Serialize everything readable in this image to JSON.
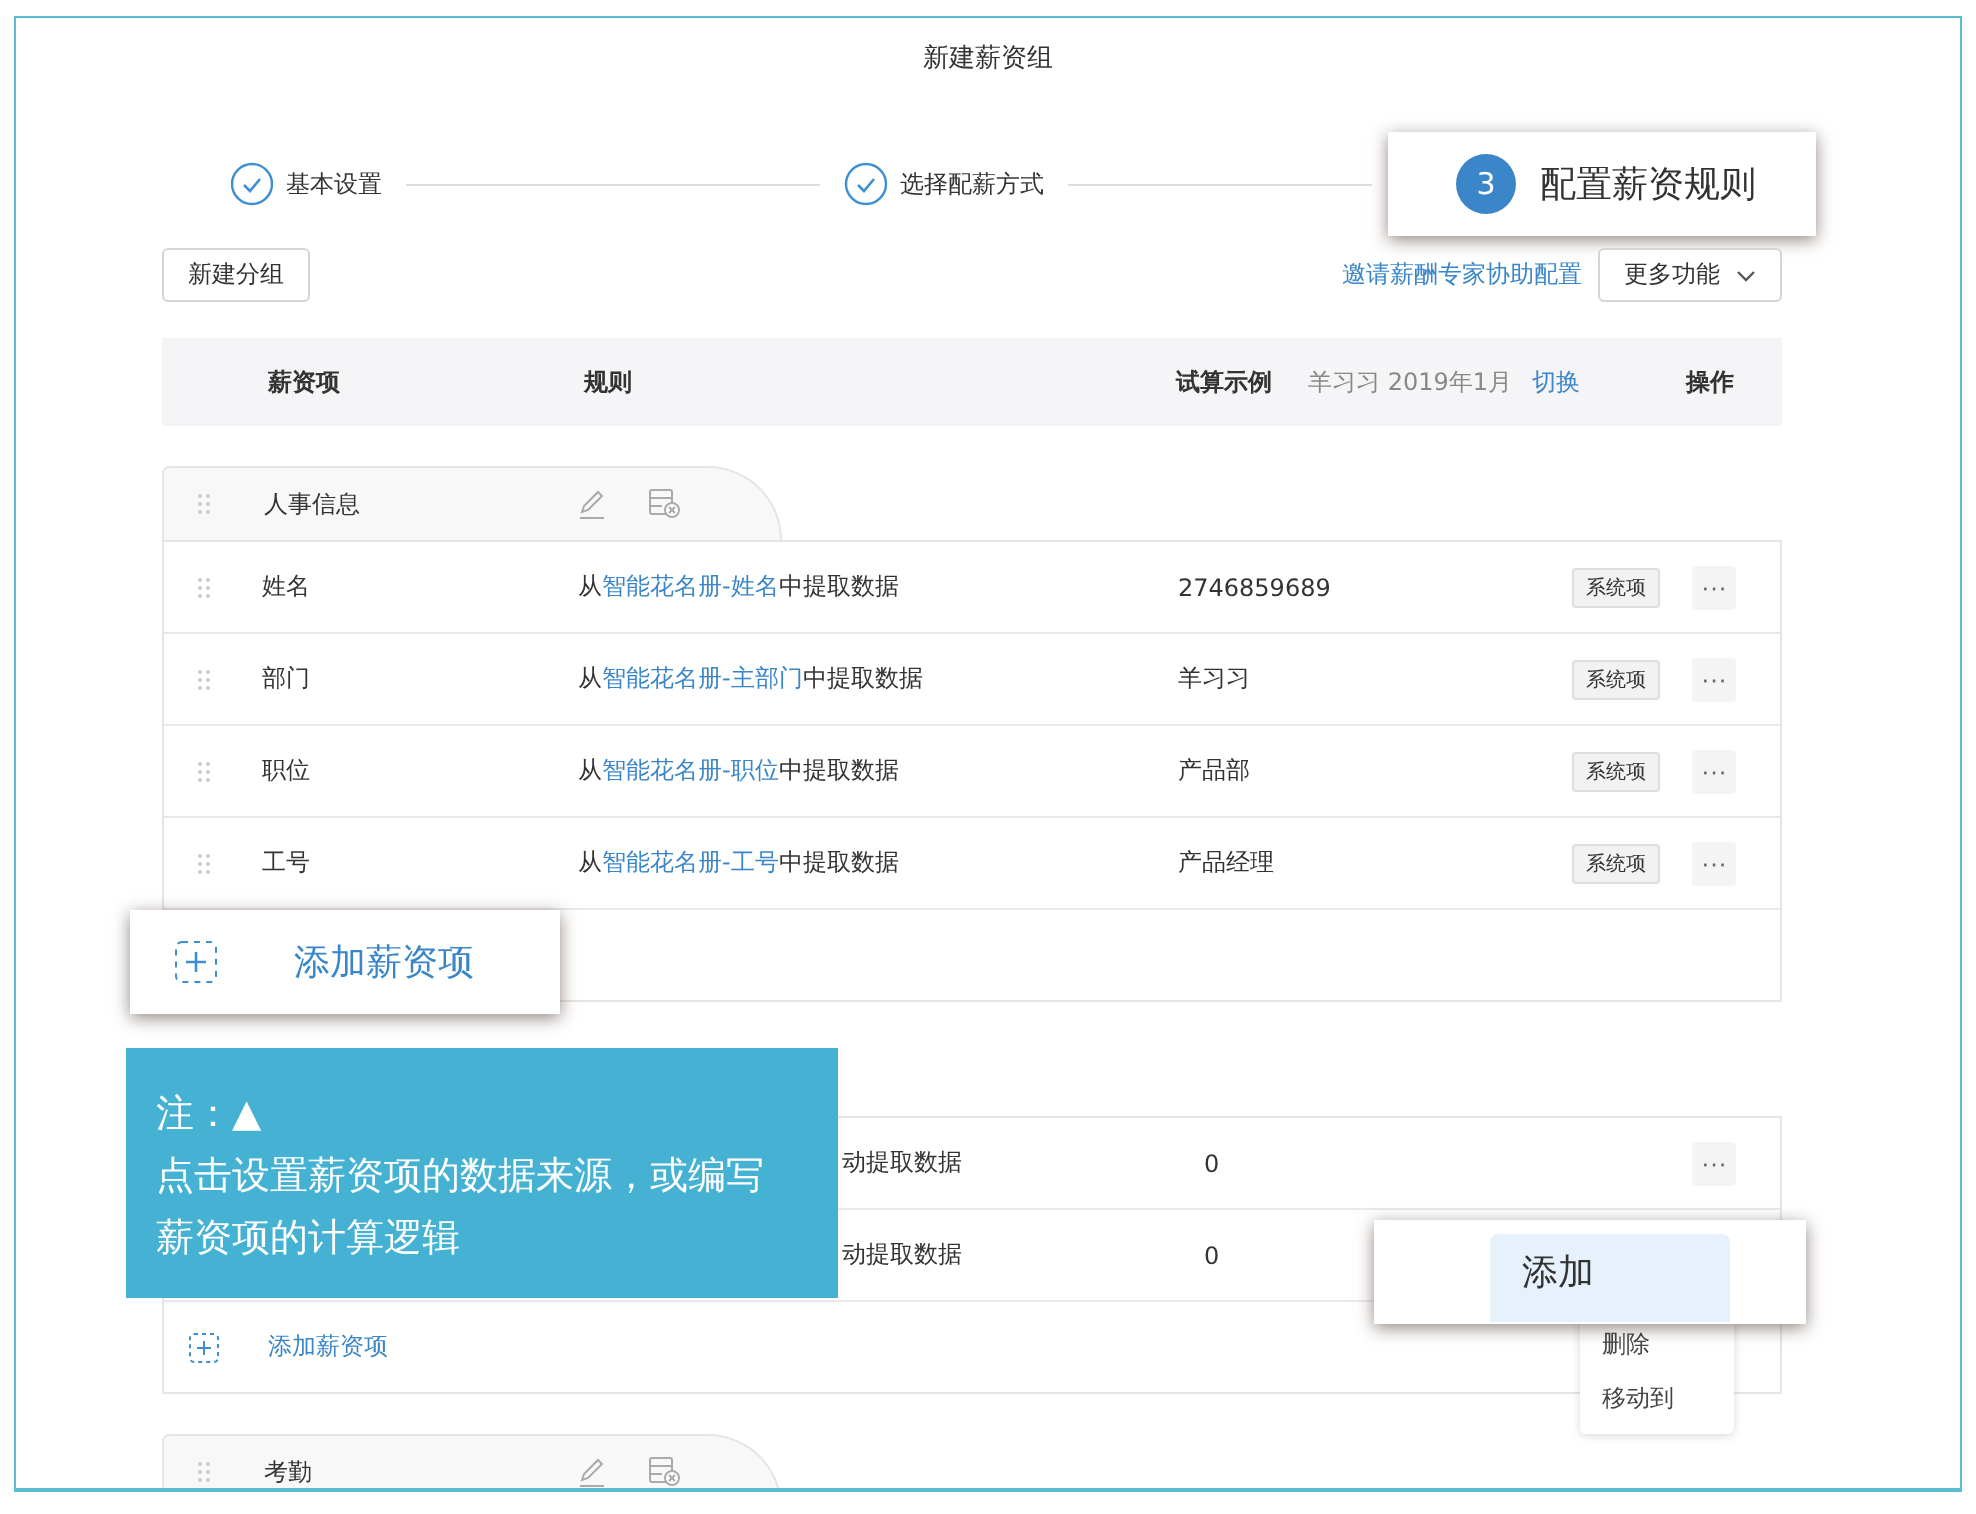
{
  "title": "新建薪资组",
  "steps": [
    {
      "label": "基本设置",
      "done": true
    },
    {
      "label": "选择配薪方式",
      "done": true
    },
    {
      "label": "配置薪资规则",
      "done": false,
      "number": "3"
    }
  ],
  "toolbar": {
    "new_group": "新建分组",
    "invite_link": "邀请薪酬专家协助配置",
    "more": "更多功能"
  },
  "header": {
    "item": "薪资项",
    "rule": "规则",
    "sample": "试算示例",
    "sample_person": "羊习习 2019年1月",
    "switch": "切换",
    "actions": "操作"
  },
  "groups": [
    {
      "name": "人事信息",
      "rows": [
        {
          "name": "姓名",
          "rule_before": "从",
          "rule_link": "智能花名册-姓名",
          "rule_after": "中提取数据",
          "sample": "2746859689",
          "tag": "系统项",
          "more": "···"
        },
        {
          "name": "部门",
          "rule_before": "从",
          "rule_link": "智能花名册-主部门",
          "rule_after": "中提取数据",
          "sample": "羊习习",
          "tag": "系统项",
          "more": "···"
        },
        {
          "name": "职位",
          "rule_before": "从",
          "rule_link": "智能花名册-职位",
          "rule_after": "中提取数据",
          "sample": "产品部",
          "tag": "系统项",
          "more": "···"
        },
        {
          "name": "工号",
          "rule_before": "从",
          "rule_link": "智能花名册-工号",
          "rule_after": "中提取数据",
          "sample": "产品经理",
          "tag": "系统项",
          "more": "···"
        }
      ]
    },
    {
      "rows": [
        {
          "rule_after": "动提取数据",
          "sample": "0",
          "more": "···"
        },
        {
          "rule_after": "动提取数据",
          "sample": "0"
        }
      ],
      "add": "添加薪资项"
    },
    {
      "name": "考勤"
    }
  ],
  "add_callout": "添加薪资项",
  "note": {
    "title": "注：▲",
    "body": "点击设置薪资项的数据来源，或编写薪资项的计算逻辑"
  },
  "menu": {
    "items": [
      {
        "label": "添加",
        "selected": true
      },
      {
        "label": "删除",
        "selected": false
      },
      {
        "label": "移动到",
        "selected": false
      }
    ]
  }
}
